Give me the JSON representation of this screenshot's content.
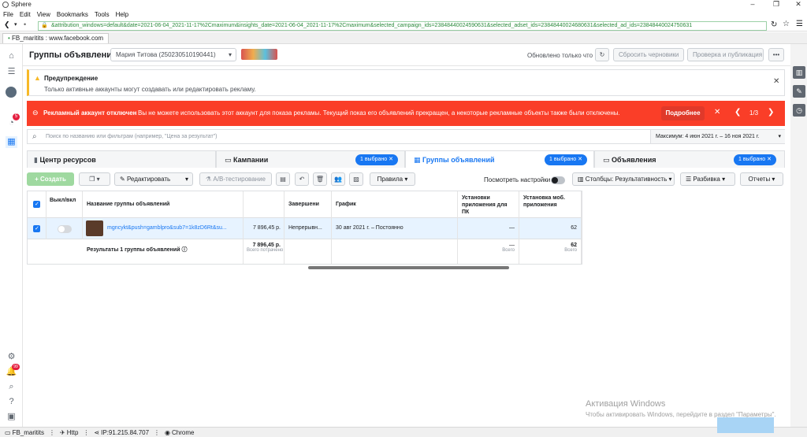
{
  "window": {
    "title": "Sphere"
  },
  "menu": [
    "File",
    "Edit",
    "View",
    "Bookmarks",
    "Tools",
    "Help"
  ],
  "address": {
    "url": "&attribution_windows=default&date=2021-06-04_2021-11-17%2Cmaximum&insights_date=2021-06-04_2021-11-17%2Cmaximum&selected_campaign_ids=23848440024590631&selected_adset_ids=23848440024680631&selected_ad_ids=23848440024750631"
  },
  "tab": {
    "label": "FB_maritits : www.facebook.com"
  },
  "header": {
    "title": "Группы объявлений",
    "account": "Мария Титова (250230510190441)",
    "updated": "Обновлено только что",
    "discard": "Сбросить черновики",
    "publish": "Проверка и публикация",
    "more": "•••"
  },
  "warning": {
    "title": "Предупреждение",
    "text": "Только активные аккаунты могут создавать или редактировать рекламу."
  },
  "error": {
    "title": "Рекламный аккаунт отключен",
    "text": "Вы не можете использовать этот аккаунт для показа рекламы. Текущий показ его объявлений прекращен, а некоторые рекламные объекты также были отключены.",
    "more": "Подробнее",
    "pager": "1/3"
  },
  "search": {
    "placeholder": "Поиск по названию или фильтрам (например, \"Цена за результат\")",
    "date_range": "Максимум: 4 июн 2021 г. – 16 ноя 2021 г."
  },
  "tabs": {
    "resources": "Центр ресурсов",
    "campaigns": "Кампании",
    "campaigns_sel": "1 выбрано",
    "adsets": "Группы объявлений",
    "adsets_sel": "1 выбрано",
    "ads": "Объявления",
    "ads_sel": "1 выбрано"
  },
  "toolbar": {
    "create": "+ Создать",
    "edit": "Редактировать",
    "ab": "А/В-тестирование",
    "rules": "Правила",
    "view_settings": "Посмотреть настройки",
    "columns": "Столбцы: Результативность",
    "breakdown": "Разбивка",
    "reports": "Отчеты"
  },
  "table": {
    "headers": {
      "toggle": "Выкл/вкл",
      "name": "Название группы объявлений",
      "ends": "Завершени",
      "schedule": "График",
      "installs_pc": "Установки приложения для ПК",
      "installs_mobile": "Установка моб. приложения"
    },
    "row": {
      "name": "mgncykt&push=gamblpro&sub7=1k8zD6Rt&su...",
      "spent": "7 896,45 р.",
      "ends": "Непрерывн...",
      "schedule": "30 авг 2021 г. – Постоянно",
      "installs_pc": "—",
      "installs_mobile": "62"
    },
    "totals": {
      "label": "Результаты 1 группы объявлений",
      "spent": "7 896,45 р.",
      "spent_caption": "Всего потрачено",
      "installs_pc": "—",
      "installs_pc_caption": "Всего",
      "installs_mobile": "62",
      "installs_mobile_caption": "Всего"
    }
  },
  "leftrail": {
    "badge1": "5",
    "badge2": "99"
  },
  "watermark": {
    "title": "Активация Windows",
    "text": "Чтобы активировать Windows, перейдите в раздел \"Параметры\"."
  },
  "statusbar": {
    "profile": "FB_maritits",
    "protocol": "Http",
    "ip": "IP:91.215.84.707",
    "browser": "Chrome"
  }
}
